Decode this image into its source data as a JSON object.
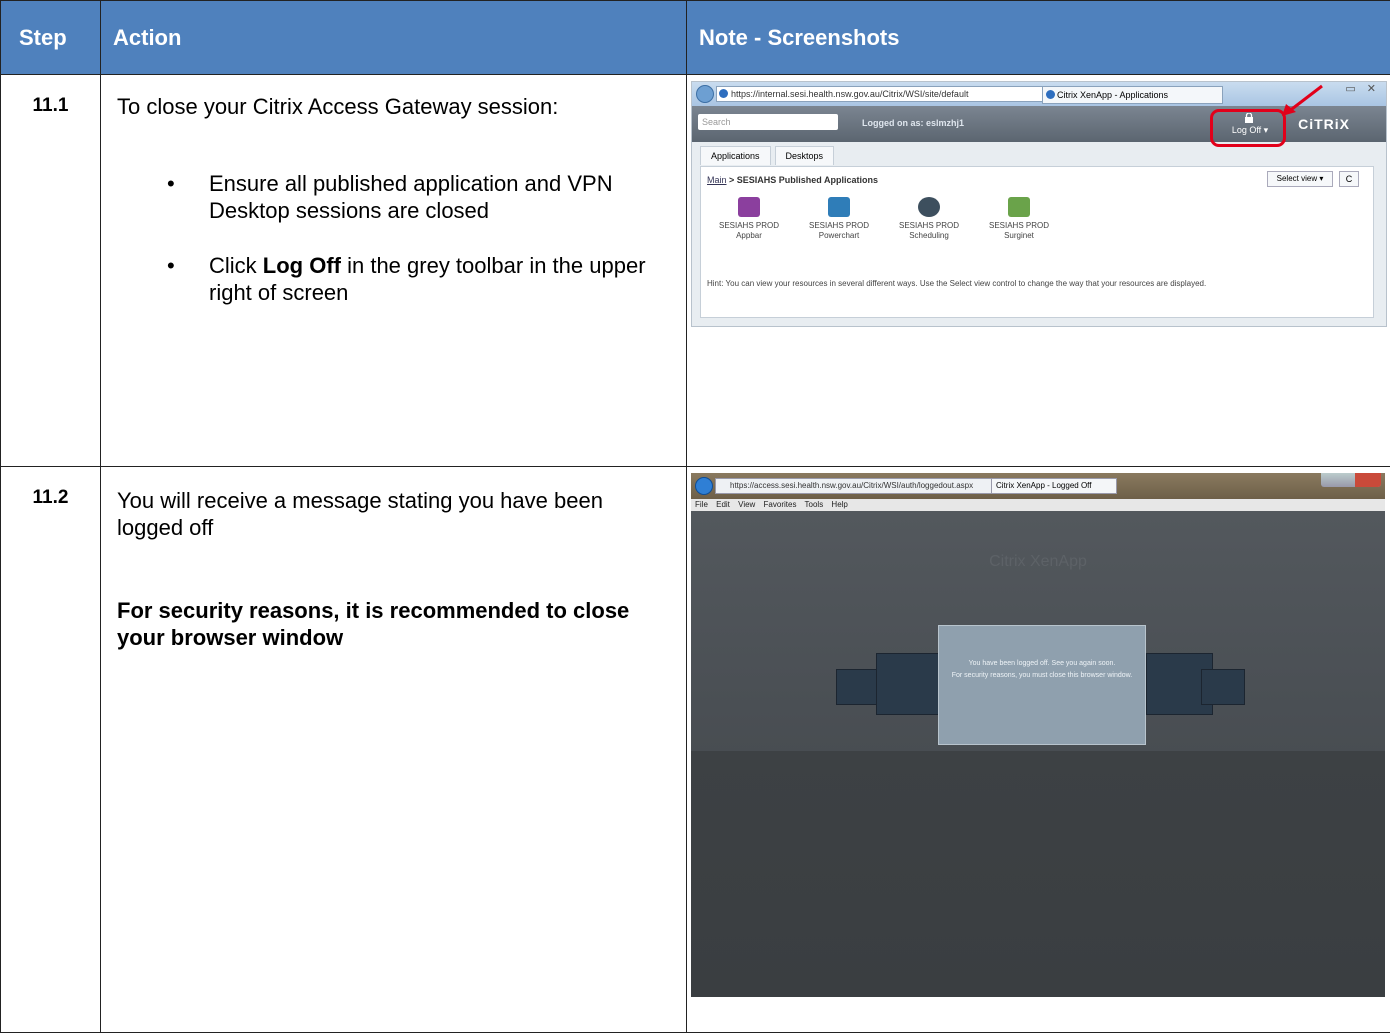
{
  "headers": {
    "step": "Step",
    "action": "Action",
    "note": "Note - Screenshots"
  },
  "rows": [
    {
      "step": "11.1",
      "intro": "To close your Citrix Access Gateway session:",
      "bullet1": "Ensure all published application and VPN Desktop sessions are closed",
      "bullet2_pre": "Click ",
      "bullet2_bold": "Log Off",
      "bullet2_post": " in the grey toolbar in the upper right of screen"
    },
    {
      "step": "11.2",
      "text1": "You will receive a message stating you have been logged off",
      "text2": "For security reasons, it is recommended to close your browser window"
    }
  ],
  "screenshot1": {
    "url": "https://internal.sesi.health.nsw.gov.au/Citrix/WSI/site/default",
    "tab": "Citrix XenApp - Applications",
    "search_placeholder": "Search",
    "logged_on": "Logged on as: eslmzhj1",
    "logoff": "Log Off ▾",
    "brand": "CiTRiX",
    "tab_apps": "Applications",
    "tab_desktops": "Desktops",
    "crumb_link": "Main",
    "crumb_rest": " > SESIAHS Published Applications",
    "select_view": "Select view ▾",
    "refresh": "C",
    "apps": [
      {
        "line1": "SESIAHS PROD",
        "line2": "Appbar",
        "color": "#8b3f9e"
      },
      {
        "line1": "SESIAHS PROD",
        "line2": "Powerchart",
        "color": "#2f7db8"
      },
      {
        "line1": "SESIAHS PROD",
        "line2": "Scheduling",
        "color": "#3d4f5e"
      },
      {
        "line1": "SESIAHS PROD",
        "line2": "Surginet",
        "color": "#6aa34a"
      }
    ],
    "hint": "Hint: You can view your resources in several different ways. Use the Select view control to change the way that your resources are displayed."
  },
  "screenshot2": {
    "url": "https://access.sesi.health.nsw.gov.au/Citrix/WSI/auth/loggedout.aspx",
    "tab": "Citrix XenApp - Logged Off",
    "menu": "File Edit View Favorites Tools Help",
    "title": "Citrix XenApp",
    "msg1": "You have been logged off. See you again soon.",
    "msg2": "For security reasons, you must close this browser window."
  }
}
